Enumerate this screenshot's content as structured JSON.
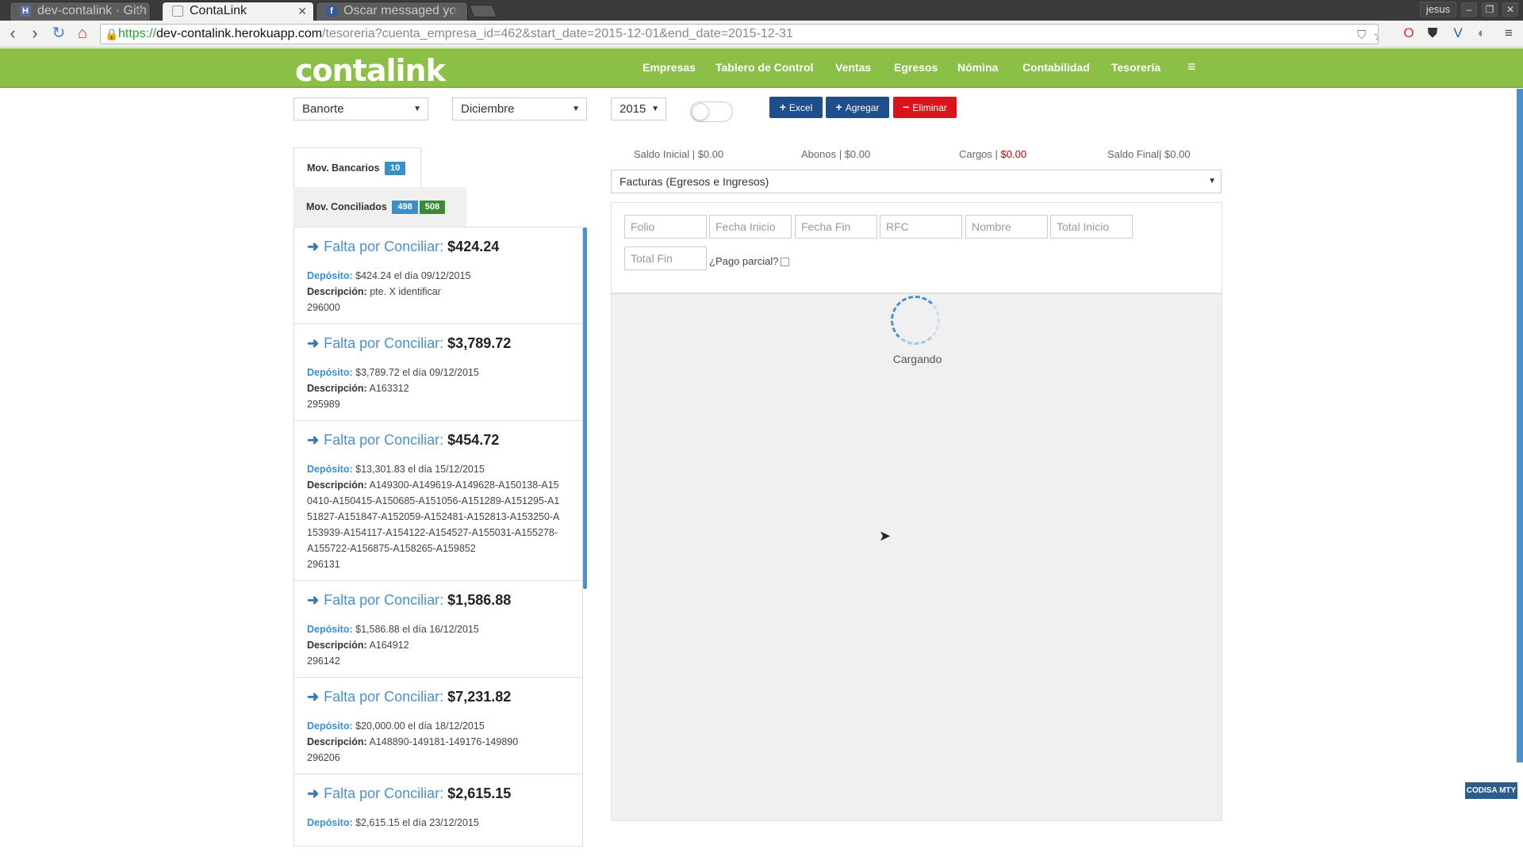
{
  "browser": {
    "tabs": [
      {
        "title": "dev-contalink · Gith",
        "favicon": "github-icon",
        "active": false
      },
      {
        "title": "ContaLink",
        "favicon": "page-icon",
        "active": true
      },
      {
        "title": "Oscar messaged yo",
        "favicon": "facebook-icon",
        "active": false
      }
    ],
    "user": "jesus",
    "url": {
      "scheme": "https://",
      "host": "dev-contalink.herokuapp.com",
      "path": "/tesoreria?cuenta_empresa_id=462&start_date=2015-12-01&end_date=2015-12-31"
    }
  },
  "app": {
    "brand": "contalink",
    "nav": [
      "Empresas",
      "Tablero de Control",
      "Ventas",
      "Egresos",
      "Nómina",
      "Contabilidad",
      "Tesorería"
    ]
  },
  "filters": {
    "bank": "Banorte",
    "month": "Diciembre",
    "year": "2015",
    "toggle_on": false
  },
  "actions": {
    "excel": "Excel",
    "agregar": "Agregar",
    "eliminar": "Eliminar"
  },
  "left": {
    "tab_bancarios": {
      "label": "Mov. Bancarios",
      "badge": "10"
    },
    "tab_conciliados": {
      "label": "Mov. Conciliados",
      "badge1": "498",
      "badge2": "508"
    },
    "head_label": "Falta por Conciliar:",
    "deposit_label": "Depósito:",
    "desc_label": "Descripción:",
    "items": [
      {
        "amount": "$424.24",
        "deposit": "$424.24 el día 09/12/2015",
        "description": "pte. X identificar",
        "ref": "296000"
      },
      {
        "amount": "$3,789.72",
        "deposit": "$3,789.72 el día 09/12/2015",
        "description": "A163312",
        "ref": "295989"
      },
      {
        "amount": "$454.72",
        "deposit": "$13,301.83 el día 15/12/2015",
        "description": "A149300-A149619-A149628-A150138-A150410-A150415-A150685-A151056-A151289-A151295-A151827-A151847-A152059-A152481-A152813-A153250-A153939-A154117-A154122-A154527-A155031-A155278-A155722-A156875-A158265-A159852",
        "ref": "296131"
      },
      {
        "amount": "$1,586.88",
        "deposit": "$1,586.88 el día 16/12/2015",
        "description": "A164912",
        "ref": "296142"
      },
      {
        "amount": "$7,231.82",
        "deposit": "$20,000.00 el día 18/12/2015",
        "description": "A148890-149181-149176-149890",
        "ref": "296206"
      },
      {
        "amount": "$2,615.15",
        "deposit": "$2,615.15 el día 23/12/2015",
        "description": "",
        "ref": ""
      }
    ]
  },
  "summary": {
    "saldo_inicial": "Saldo Inicial | $0.00",
    "abonos": "Abonos | $0.00",
    "cargos_label": "Cargos |",
    "cargos_value": "$0.00",
    "saldo_final": "Saldo Final| $0.00"
  },
  "facturas": {
    "selected": "Facturas (Egresos e Ingresos)",
    "placeholders": {
      "folio": "Folio",
      "fecha_inicio": "Fecha Inicio",
      "fecha_fin": "Fecha Fin",
      "rfc": "RFC",
      "nombre": "Nombre",
      "total_inicio": "Total Inicio",
      "total_fin": "Total Fin"
    },
    "pago_parcial": "¿Pago parcial?",
    "loading": "Cargando"
  },
  "footer_badge": "CODISA MTY",
  "colors": {
    "brand_green": "#8cbf45",
    "primary_blue": "#1f4e8c",
    "danger_red": "#d9141a",
    "badge_blue": "#3a8fc4",
    "badge_green": "#3d8a36",
    "link_blue": "#4a90d0"
  }
}
